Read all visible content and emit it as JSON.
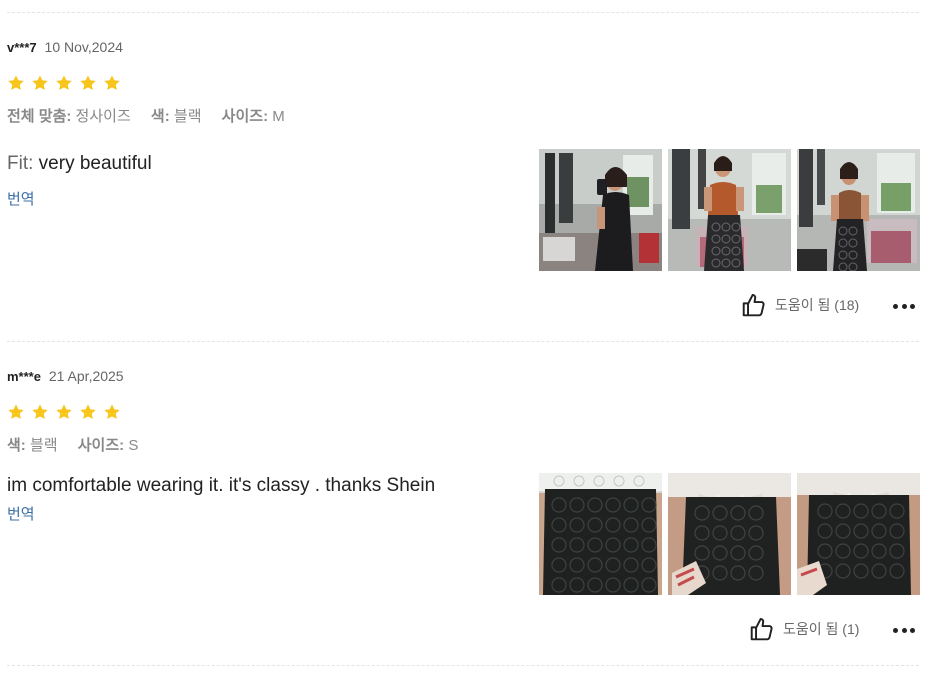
{
  "colors": {
    "star": "#F7C51C",
    "link": "#3B6FA6",
    "divider": "#E4E4E4"
  },
  "reviews": [
    {
      "user": "v***7",
      "date": "10 Nov,2024",
      "rating": 5,
      "attributes": [
        {
          "key": "전체 맞춤:",
          "value": "정사이즈"
        },
        {
          "key": "색:",
          "value": "블랙"
        },
        {
          "key": "사이즈:",
          "value": "M"
        }
      ],
      "fit_label": "Fit:",
      "text": "very beautiful",
      "translate": "번역",
      "helpful": "도움이 됨 (18)",
      "photos": [
        {
          "name": "review-photo-black-cami-selfie"
        },
        {
          "name": "review-photo-orange-top-lace-skirt"
        },
        {
          "name": "review-photo-brown-cami-lace-skirt"
        }
      ]
    },
    {
      "user": "m***e",
      "date": "21 Apr,2025",
      "rating": 5,
      "attributes": [
        {
          "key": "색:",
          "value": "블랙"
        },
        {
          "key": "사이즈:",
          "value": "S"
        }
      ],
      "text": "im comfortable wearing it. it's classy . thanks Shein",
      "translate": "번역",
      "helpful": "도움이 됨 (1)",
      "photos": [
        {
          "name": "review-photo-lace-skirt-closeup"
        },
        {
          "name": "review-photo-lace-skirt-with-bag"
        },
        {
          "name": "review-photo-lace-skirt-side"
        }
      ]
    }
  ]
}
